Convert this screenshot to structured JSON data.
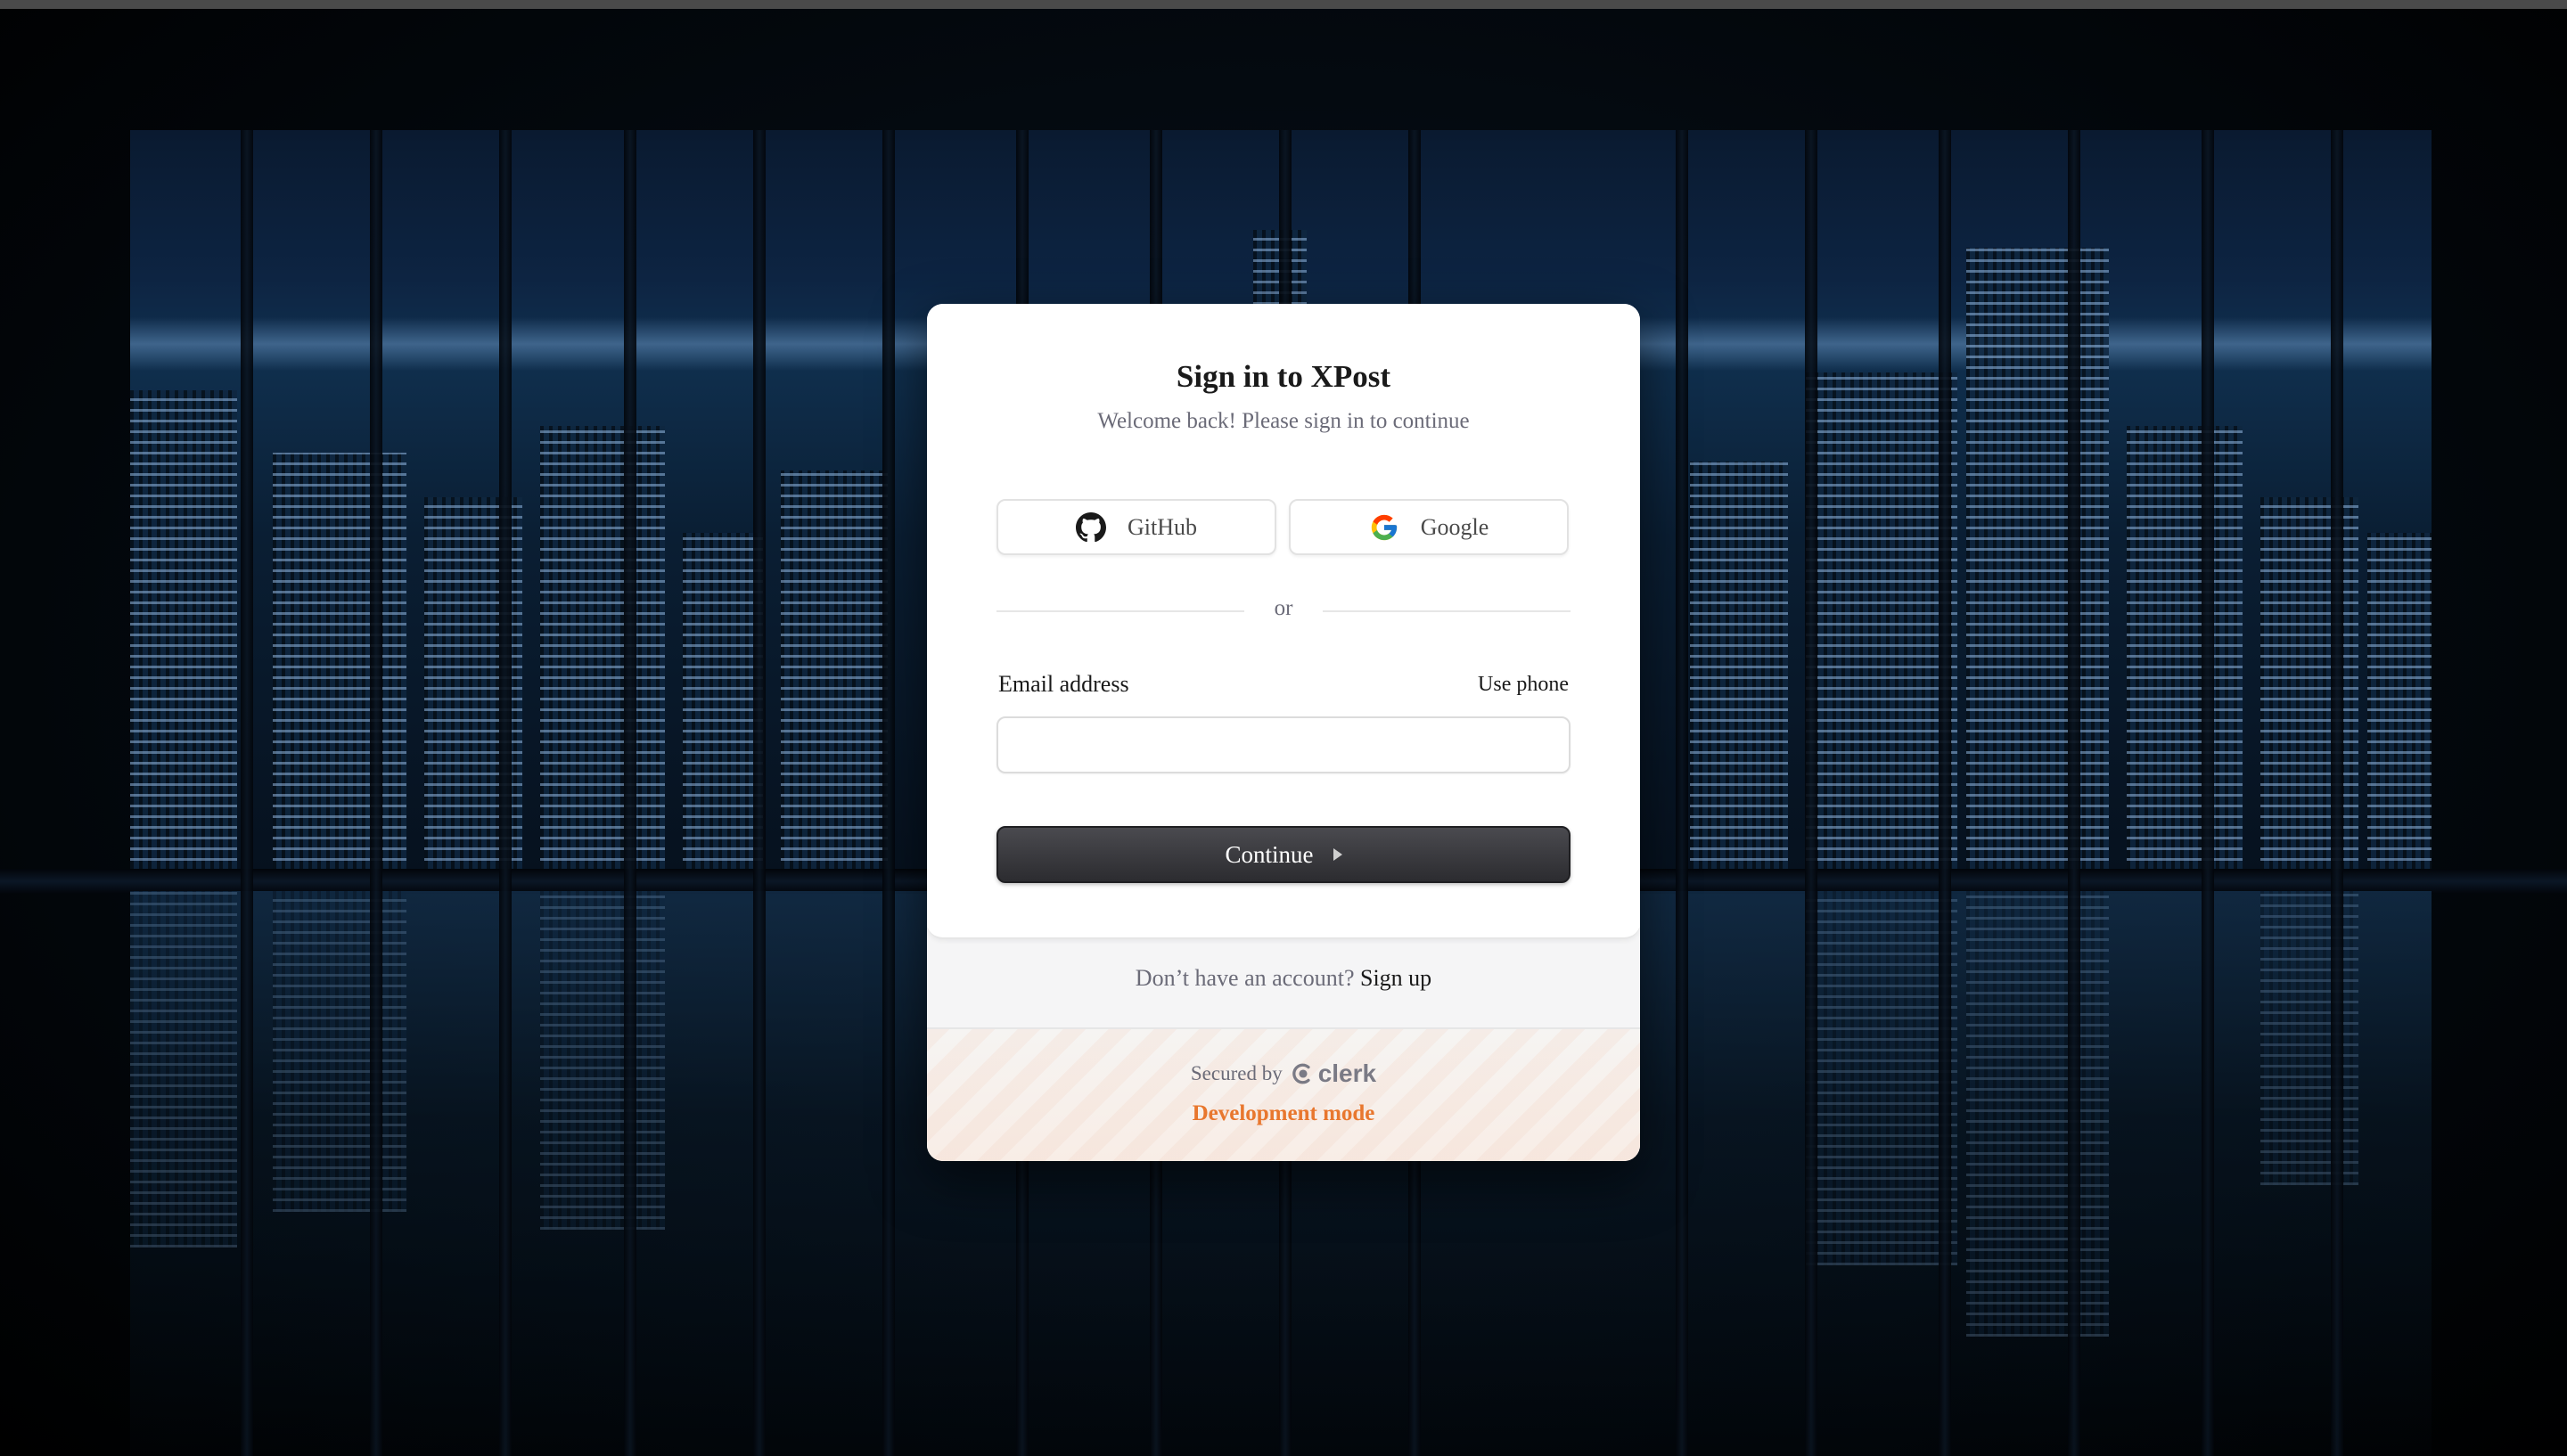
{
  "card": {
    "title": "Sign in to XPost",
    "subtitle": "Welcome back! Please sign in to continue"
  },
  "social": {
    "github_label": "GitHub",
    "github_icon": "github-icon",
    "google_label": "Google",
    "google_icon": "google-icon"
  },
  "divider": {
    "text": "or"
  },
  "form": {
    "email_label": "Email address",
    "use_phone_label": "Use phone",
    "email_value": "",
    "email_placeholder": "",
    "continue_label": "Continue",
    "continue_icon": "triangle-right-icon"
  },
  "footer": {
    "no_account_text": "Don’t have an account?",
    "signup_label": "Sign up",
    "secured_by_text": "Secured by",
    "clerk_brand": "clerk",
    "dev_mode_text": "Development mode"
  },
  "colors": {
    "background": "#000000",
    "card": "#ffffff",
    "primary_button": "#2c2c30",
    "dev_mode": "#e8772e",
    "muted_text": "#6b6b78"
  }
}
